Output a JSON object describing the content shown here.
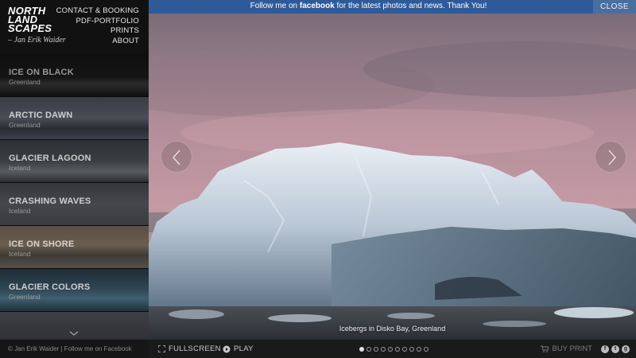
{
  "brand": {
    "logo": [
      "NORTH",
      "LAND",
      "SCAPES"
    ],
    "author": "– Jan Erik Waider"
  },
  "topnav": {
    "items": [
      "CONTACT & BOOKING",
      "PDF-PORTFOLIO",
      "PRINTS",
      "ABOUT"
    ]
  },
  "gallery": {
    "items": [
      {
        "title": "ICE ON BLACK",
        "subtitle": "Greenland"
      },
      {
        "title": "ARCTIC DAWN",
        "subtitle": "Greenland"
      },
      {
        "title": "GLACIER LAGOON",
        "subtitle": "Iceland"
      },
      {
        "title": "CRASHING WAVES",
        "subtitle": "Iceland"
      },
      {
        "title": "ICE ON SHORE",
        "subtitle": "Iceland"
      },
      {
        "title": "GLACIER COLORS",
        "subtitle": "Greenland"
      }
    ]
  },
  "sidebar_footer": {
    "text": "© Jan Erik Waider  |  Follow me on Facebook"
  },
  "banner": {
    "prefix": "Follow me on ",
    "brand": "facebook",
    "suffix": " for the latest photos and news. Thank You!",
    "close_label": "CLOSE"
  },
  "viewer": {
    "caption": "Icebergs in Disko Bay, Greenland"
  },
  "bottombar": {
    "fullscreen_label": "FULLSCREEN",
    "play_label": "PLAY",
    "buy_print_label": "BUY PRINT",
    "slide_count": 10,
    "active_slide": 1
  },
  "social": [
    "f",
    "t",
    "g"
  ],
  "colors": {
    "banner": "#2f5a9a",
    "sidebar": "#111111",
    "sky": "#b98f9c"
  }
}
